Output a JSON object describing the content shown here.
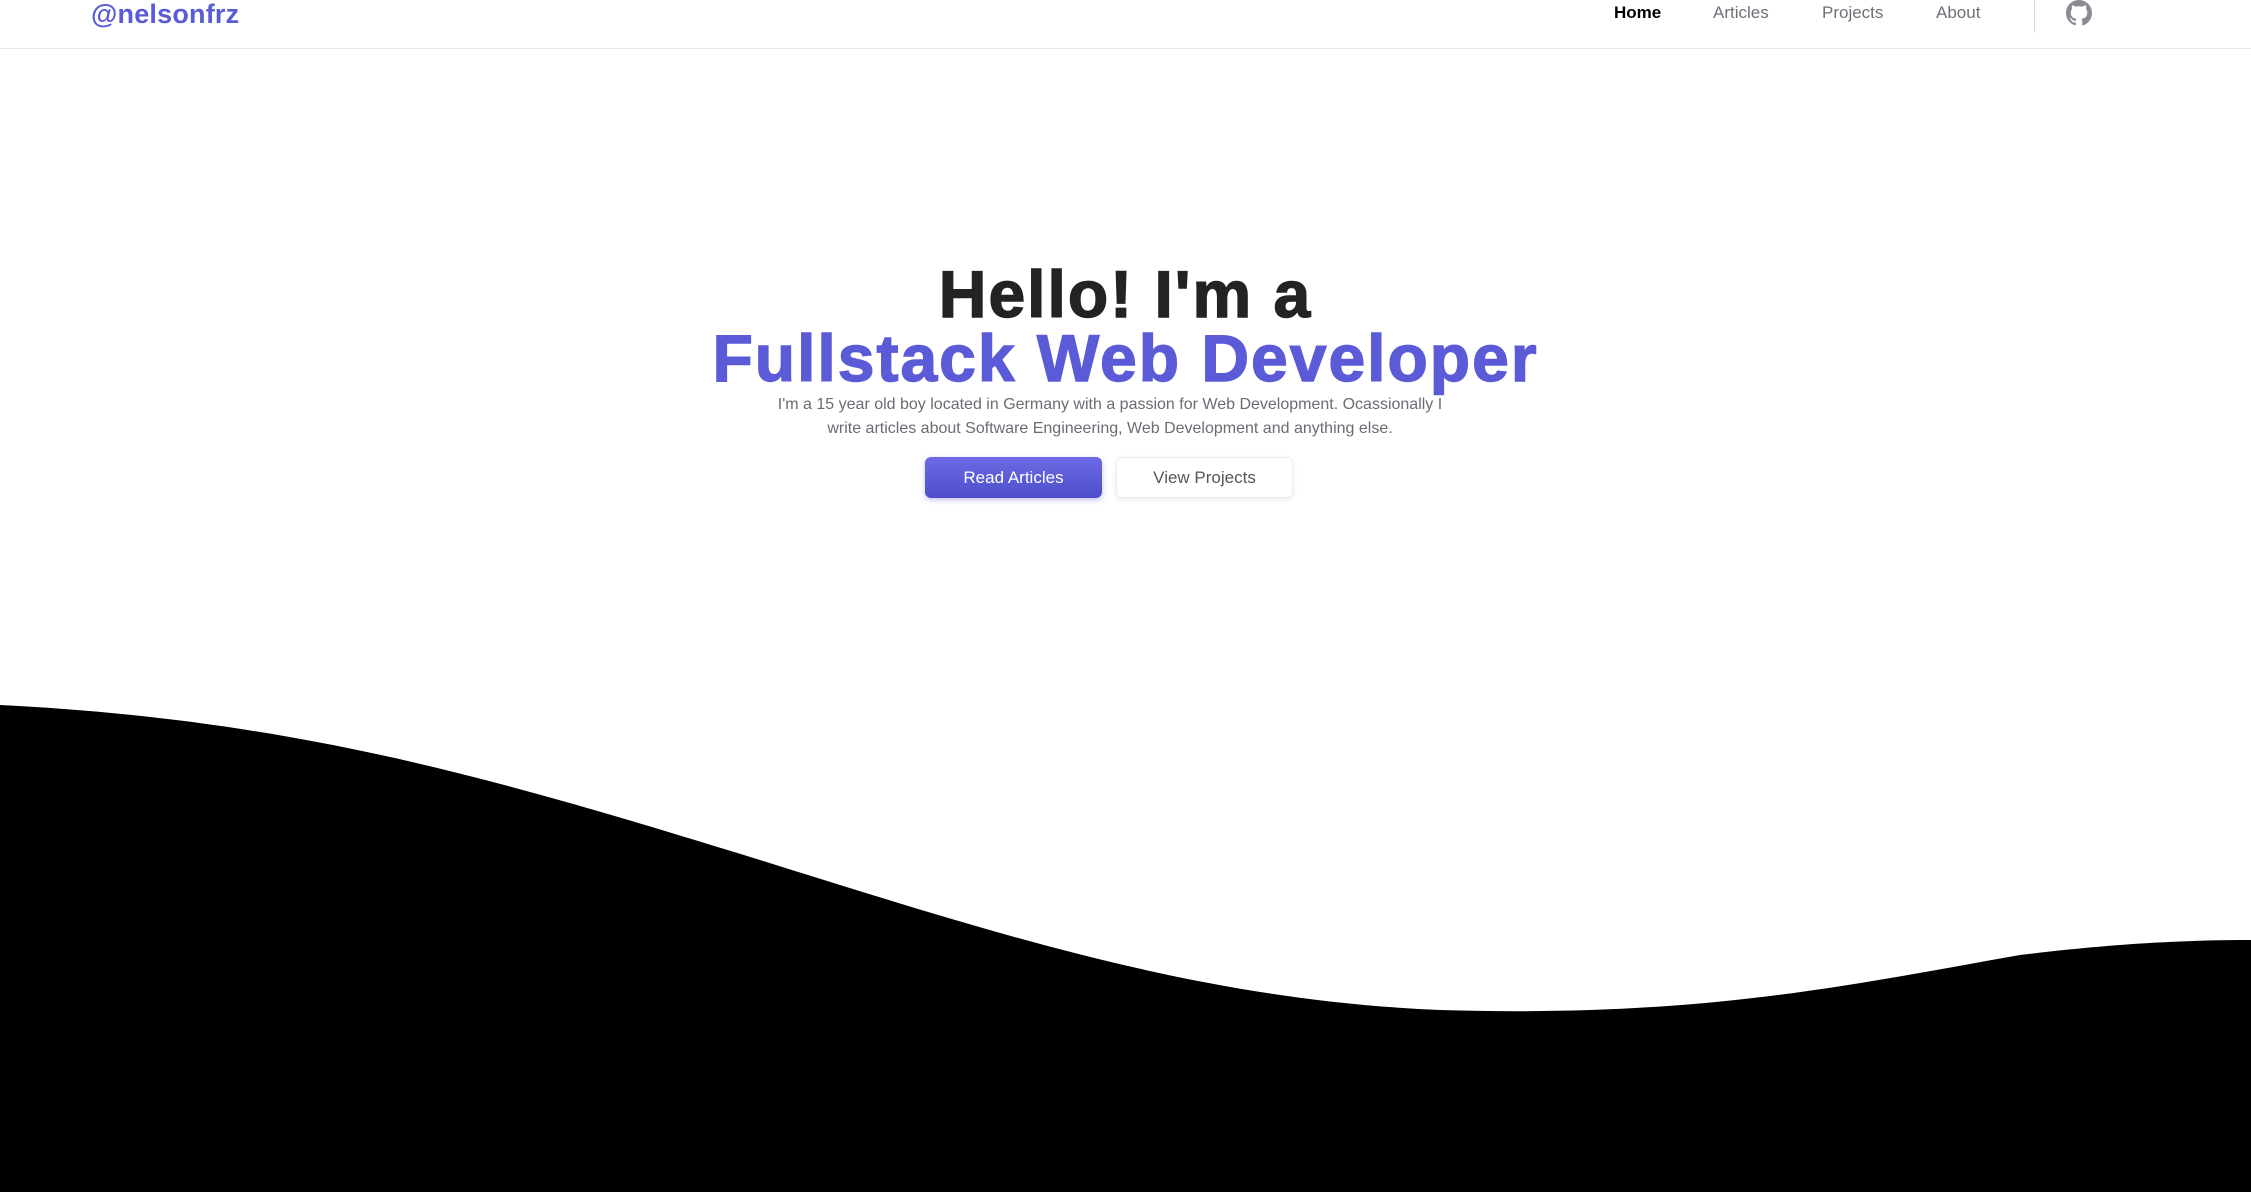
{
  "header": {
    "logo": "@nelsonfrz",
    "nav": [
      {
        "label": "Home",
        "active": true
      },
      {
        "label": "Articles",
        "active": false
      },
      {
        "label": "Projects",
        "active": false
      },
      {
        "label": "About",
        "active": false
      }
    ],
    "github_icon": "github-icon"
  },
  "hero": {
    "line1": "Hello! I'm a",
    "line2": "Fullstack Web Developer",
    "description_line1": "I'm a 15 year old boy located in Germany with a passion for Web Development. Ocassionally I",
    "description_line2": "write articles about Software Engineering, Web Development and anything else.",
    "primary_button": "Read Articles",
    "secondary_button": "View Projects"
  },
  "colors": {
    "accent": "#5b5bd8",
    "heading": "#232323",
    "wave": "#000000"
  }
}
